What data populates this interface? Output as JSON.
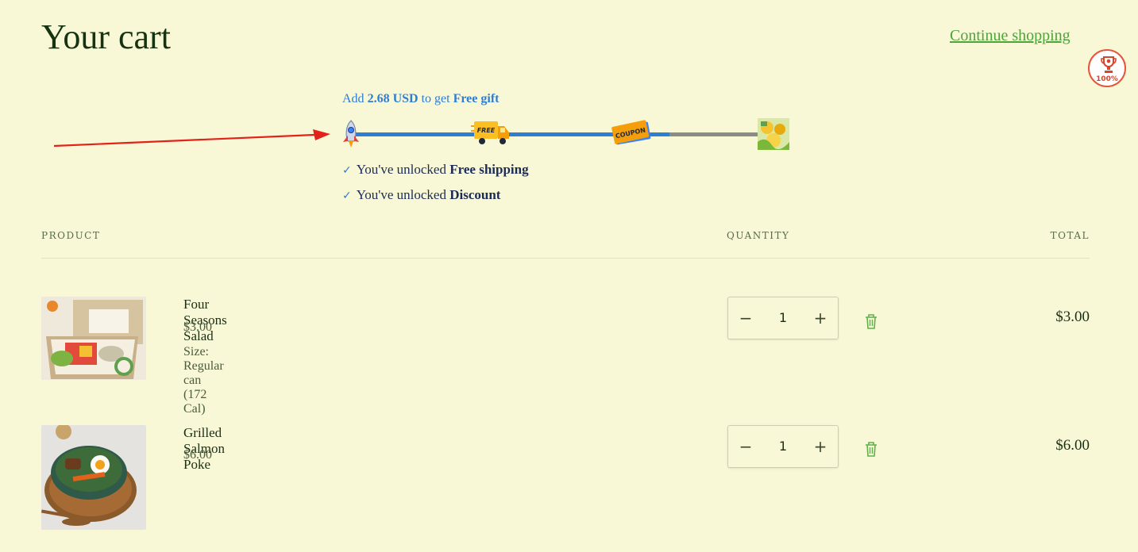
{
  "header": {
    "title": "Your cart",
    "continue_label": "Continue shopping",
    "badge_text": "100%"
  },
  "reward": {
    "msg_prefix": "Add",
    "msg_amount": "2.68 USD",
    "msg_mid": "to get",
    "msg_goal": "Free gift",
    "progress": 0.75,
    "milestones": [
      {
        "icon": "rocket-icon"
      },
      {
        "icon": "free-shipping-truck-icon",
        "label": "FREE"
      },
      {
        "icon": "coupon-icon",
        "label": "COUPON"
      },
      {
        "icon": "gift-image-icon"
      }
    ],
    "unlocked": [
      {
        "prefix": "You've unlocked",
        "item": "Free shipping"
      },
      {
        "prefix": "You've unlocked",
        "item": "Discount"
      }
    ],
    "colors": {
      "filled": "#2e7ed3",
      "empty": "#8a8d86"
    }
  },
  "table": {
    "headers": {
      "product": "PRODUCT",
      "quantity": "QUANTITY",
      "total": "TOTAL"
    }
  },
  "items": [
    {
      "name": "Four Seasons Salad",
      "price": "$3.00",
      "meta": "Size: Regular can (172 Cal)",
      "quantity": "1",
      "total": "$3.00"
    },
    {
      "name": "Grilled Salmon Poke",
      "price": "$6.00",
      "meta": "",
      "quantity": "1",
      "total": "$6.00"
    }
  ],
  "qty_controls": {
    "minus": "−",
    "plus": "+"
  }
}
